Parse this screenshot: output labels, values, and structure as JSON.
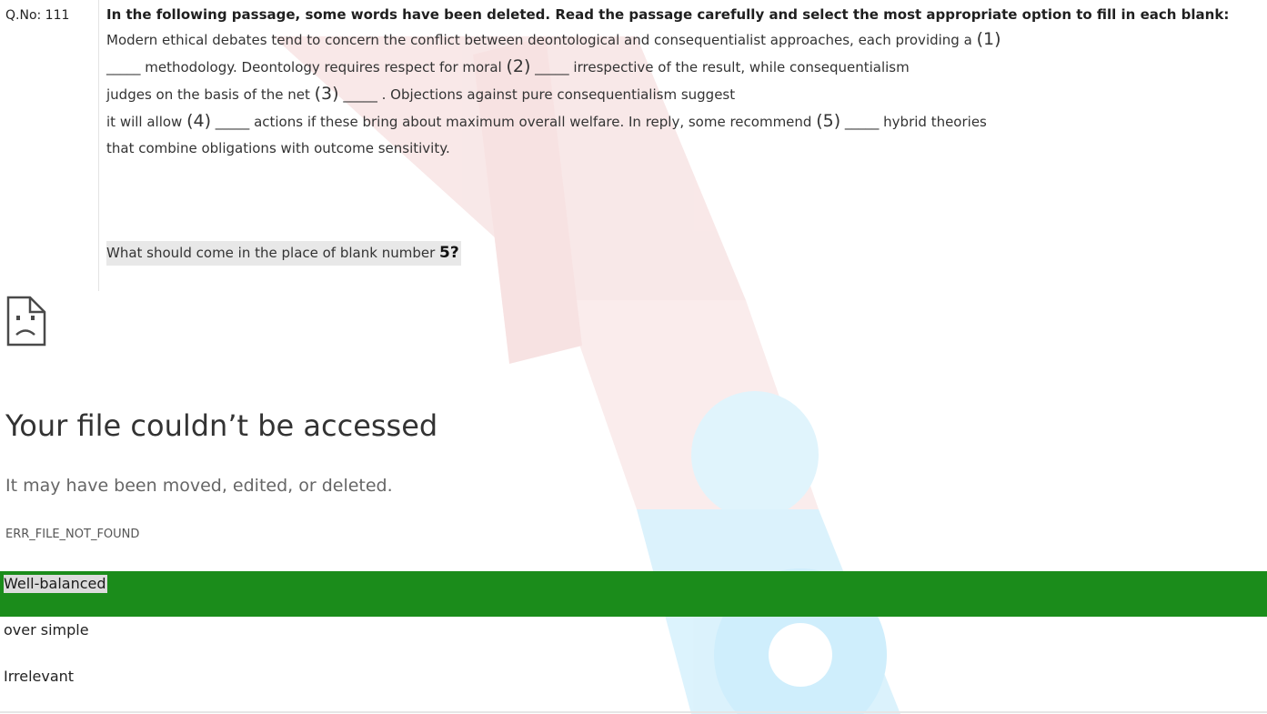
{
  "question": {
    "number_label": "Q.No: 111",
    "instruction": "In the following passage, some words have been deleted. Read the passage carefully and select the most appropriate option to fill in each blank:",
    "passage": [
      [
        "Modern ethical debates tend to concern the conflict between deontological and consequentialist approaches, each providing a ",
        "(1)"
      ],
      [
        "_____ methodology. Deontology requires respect for moral ",
        "(2)",
        " _____ irrespective of the result, while consequentialism"
      ],
      [
        "judges on the basis of the net ",
        "(3)",
        " _____ . Objections against pure consequentialism suggest"
      ],
      [
        "it will allow ",
        "(4)",
        " _____ actions if these bring about maximum overall welfare. In reply, some recommend ",
        "(5)",
        " _____ hybrid theories"
      ],
      [
        "that combine obligations with outcome sensitivity."
      ]
    ],
    "prompt_prefix": "What should come in the place of blank number ",
    "prompt_number": "5",
    "prompt_suffix": "?"
  },
  "error": {
    "icon": "broken-document-icon",
    "title": "Your file couldn’t be accessed",
    "subtitle": "It may have been moved, edited, or deleted.",
    "code": "ERR_FILE_NOT_FOUND"
  },
  "options": [
    {
      "label": "Well-balanced",
      "selected": true
    },
    {
      "label": "over simple",
      "selected": false
    },
    {
      "label": "Irrelevant",
      "selected": false
    }
  ],
  "colors": {
    "selected_option_bg": "#1b8c1b",
    "watermark_red": "#f3c9c9",
    "watermark_blue": "#c9ecfa"
  },
  "watermark": "oliveboard"
}
